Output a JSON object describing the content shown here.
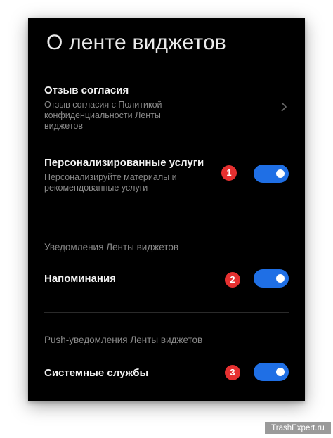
{
  "screen": {
    "title": "О ленте виджетов"
  },
  "consent": {
    "title": "Отзыв согласия",
    "subtitle": "Отзыв согласия с Политикой конфиденциальности Ленты виджетов",
    "chevron_icon": "chevron-right-icon"
  },
  "personalized": {
    "title": "Персонализированные услуги",
    "subtitle": "Персонализируйте материалы и рекомендованные услуги",
    "enabled": true,
    "badge": "1"
  },
  "notifications_section": {
    "header": "Уведомления Ленты виджетов"
  },
  "reminders": {
    "title": "Напоминания",
    "enabled": true,
    "badge": "2"
  },
  "push_section": {
    "header": "Push-уведомления Ленты виджетов"
  },
  "system_services": {
    "title": "Системные службы",
    "enabled": true,
    "badge": "3"
  },
  "colors": {
    "background": "#000000",
    "toggle_on": "#1f6fe5",
    "badge": "#e63030"
  },
  "watermark": "TrashExpert.ru"
}
